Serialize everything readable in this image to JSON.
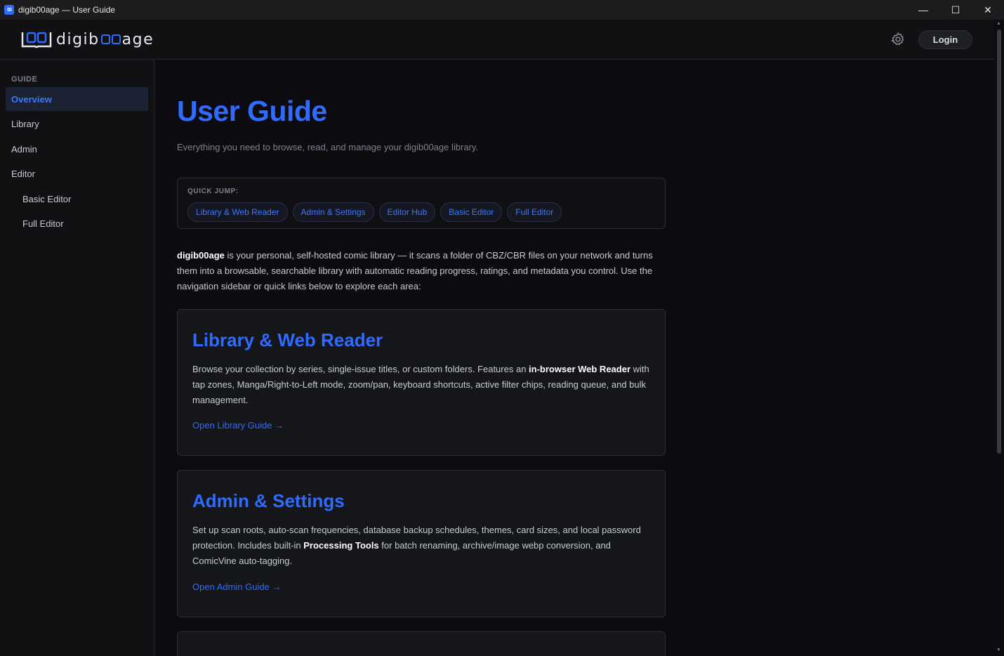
{
  "window": {
    "title": "digib00age — User Guide",
    "icon_label": "00",
    "controls": {
      "minimize": "—",
      "maximize": "☐",
      "close": "✕"
    }
  },
  "header": {
    "logo": {
      "prefix": "digib",
      "suffix": "age"
    },
    "settings_icon": "gear-icon",
    "login_label": "Login"
  },
  "sidebar": {
    "section": "GUIDE",
    "items": [
      {
        "label": "Overview",
        "active": true,
        "sub": false
      },
      {
        "label": "Library",
        "active": false,
        "sub": false
      },
      {
        "label": "Admin",
        "active": false,
        "sub": false
      },
      {
        "label": "Editor",
        "active": false,
        "sub": false
      },
      {
        "label": "Basic Editor",
        "active": false,
        "sub": true
      },
      {
        "label": "Full Editor",
        "active": false,
        "sub": true
      }
    ]
  },
  "main": {
    "title": "User Guide",
    "subtitle": "Everything you need to browse, read, and manage your digib00age library.",
    "quick_jump": {
      "label": "QUICK JUMP:",
      "chips": [
        "Library & Web Reader",
        "Admin & Settings",
        "Editor Hub",
        "Basic Editor",
        "Full Editor"
      ]
    },
    "intro": {
      "brand": "digib00age",
      "text": " is your personal, self-hosted comic library — it scans a folder of CBZ/CBR files on your network and turns them into a browsable, searchable library with automatic reading progress, ratings, and metadata you control. Use the navigation sidebar or quick links below to explore each area:"
    },
    "cards": [
      {
        "title": "Library & Web Reader",
        "body_pre": "Browse your collection by series, single-issue titles, or custom folders. Features an ",
        "body_bold": "in-browser Web Reader",
        "body_post": " with tap zones, Manga/Right-to-Left mode, zoom/pan, keyboard shortcuts, active filter chips, reading queue, and bulk management.",
        "link": "Open Library Guide →"
      },
      {
        "title": "Admin & Settings",
        "body_pre": "Set up scan roots, auto-scan frequencies, database backup schedules, themes, card sizes, and local password protection. Includes built-in ",
        "body_bold": "Processing Tools",
        "body_post": " for batch renaming, archive/image webp conversion, and ComicVine auto-tagging.",
        "link": "Open Admin Guide →"
      }
    ]
  }
}
